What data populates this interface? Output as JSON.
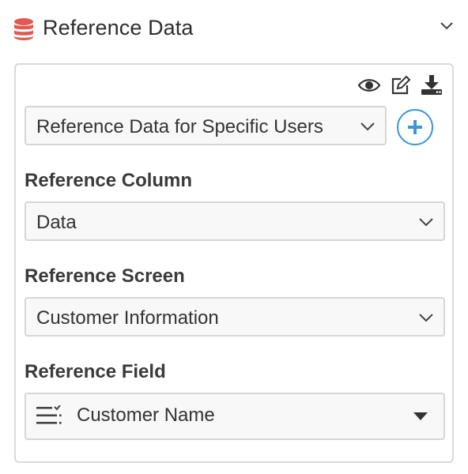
{
  "header": {
    "title": "Reference Data",
    "icon": "database-icon",
    "icon_color": "#e05a4f",
    "collapse_icon": "chevron-down-icon"
  },
  "panel": {
    "toolbar": {
      "icons": [
        "eye-icon",
        "edit-icon",
        "download-icon"
      ]
    },
    "dataset_select": {
      "value": "Reference Data for Specific Users"
    },
    "add_button": {
      "icon": "plus-icon",
      "color": "#3f95d8"
    },
    "reference_column": {
      "label": "Reference Column",
      "value": "Data"
    },
    "reference_screen": {
      "label": "Reference Screen",
      "value": "Customer Information"
    },
    "reference_field": {
      "label": "Reference Field",
      "value": "Customer Name",
      "icon": "field-list-icon"
    }
  }
}
